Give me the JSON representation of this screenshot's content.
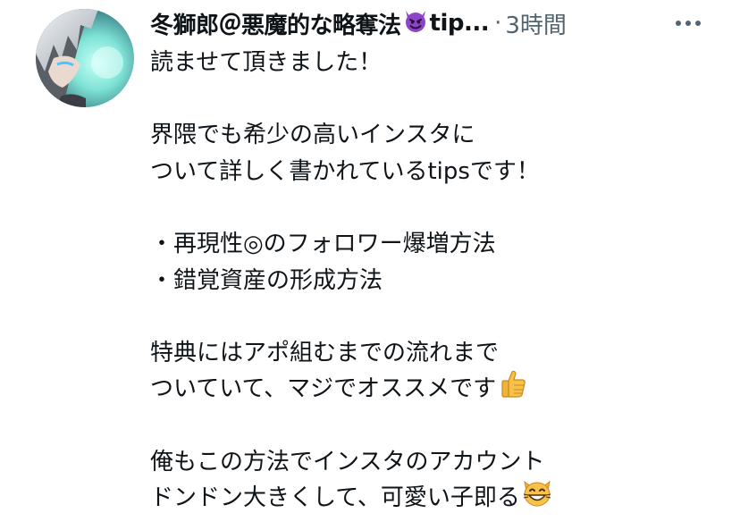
{
  "tweet": {
    "author_name": "冬獅郎＠悪魔的な略奪法",
    "author_name_suffix": "tip...",
    "author_emoji_icon": "smiling-devil-emoji",
    "separator": "·",
    "timestamp": "3時間",
    "more_icon": "more-horizontal-icon",
    "avatar_icon": "profile-avatar",
    "lines": [
      "読ませて頂きました！",
      "",
      "界隈でも希少の高いインスタに",
      "ついて詳しく書かれているtipsです！",
      "",
      "・再現性◎のフォロワー爆増方法",
      "・錯覚資産の形成方法",
      "",
      "特典にはアポ組むまでの流れまで",
      "ついていて、マジでオススメです",
      "",
      "俺もこの方法でインスタのアカウント",
      "ドンドン大きくして、可愛い子即る"
    ],
    "line10_emoji_icon": "thumbs-up-emoji",
    "line13_emoji_icon": "grinning-cat-emoji",
    "colors": {
      "text": "#0f1419",
      "secondary": "#536471",
      "devil_purple": "#8e44c9"
    }
  }
}
